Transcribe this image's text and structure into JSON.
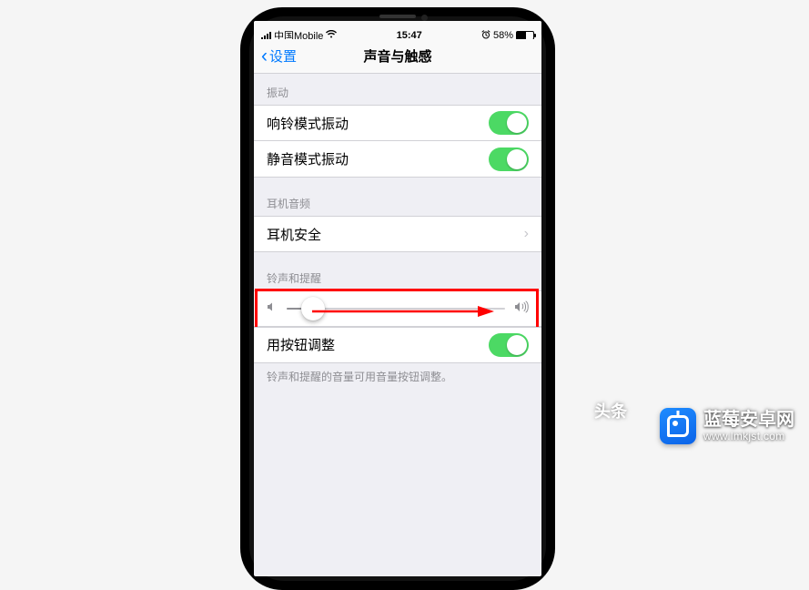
{
  "status_bar": {
    "carrier": "中国Mobile",
    "time": "15:47",
    "battery_pct": "58%"
  },
  "nav": {
    "back_label": "设置",
    "title": "声音与触感"
  },
  "sections": {
    "vibrate_header": "振动",
    "ring_vibrate": "响铃模式振动",
    "silent_vibrate": "静音模式振动",
    "headphone_header": "耳机音频",
    "headphone_safety": "耳机安全",
    "ringer_header": "铃声和提醒",
    "button_adjust": "用按钮调整",
    "hint_text": "铃声和提醒的音量可用音量按钮调整。"
  },
  "slider": {
    "value_pct": 12
  },
  "watermark": {
    "cut_text": "头条",
    "site_name": "蓝莓安卓网",
    "site_url": "www.lmkjst.com"
  }
}
